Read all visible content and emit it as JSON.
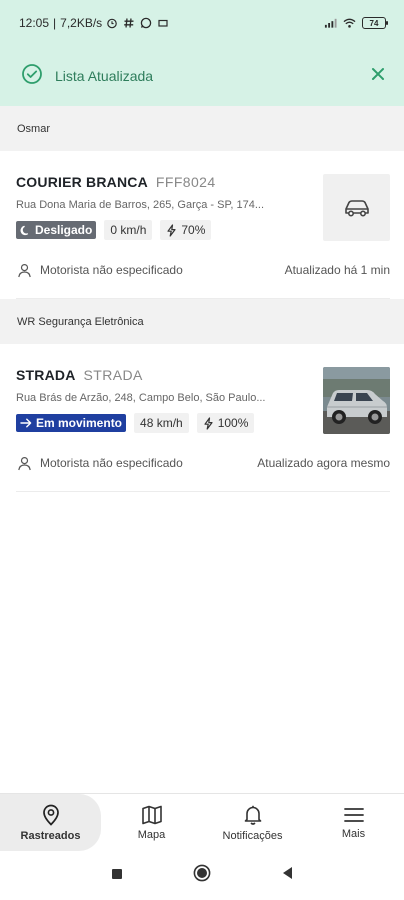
{
  "status_bar": {
    "time": "12:05",
    "network_speed": "7,2KB/s",
    "battery": "74",
    "icons": [
      "alarm-icon",
      "hashtag-icon",
      "whatsapp-icon",
      "mail-icon",
      "signal-icon",
      "wifi-icon",
      "battery-icon"
    ]
  },
  "banner": {
    "message": "Lista Atualizada",
    "icons": [
      "check-circle-icon",
      "close-icon"
    ]
  },
  "groups": [
    {
      "name": "Osmar",
      "vehicles": [
        {
          "name": "COURIER BRANCA",
          "plate": "FFF8024",
          "address": "Rua Dona Maria de Barros, 265, Garça - SP, 174...",
          "status": "Desligado",
          "speed": "0 km/h",
          "battery": "70%",
          "driver": "Motorista não especificado",
          "updated": "Atualizado há 1 min",
          "thumb": "car-outline-icon"
        }
      ]
    },
    {
      "name": "WR Segurança Eletrônica",
      "vehicles": [
        {
          "name": "STRADA",
          "plate": "STRADA",
          "address": "Rua Brás de Arzão, 248, Campo Belo, São Paulo...",
          "status": "Em movimento",
          "speed": "48 km/h",
          "battery": "100%",
          "driver": "Motorista não especificado",
          "updated": "Atualizado agora mesmo",
          "thumb": "vehicle-photo"
        }
      ]
    }
  ],
  "bottom_nav": [
    {
      "label": "Rastreados",
      "icon": "location-pin-icon",
      "active": true
    },
    {
      "label": "Mapa",
      "icon": "map-icon",
      "active": false
    },
    {
      "label": "Notificações",
      "icon": "bell-icon",
      "active": false
    },
    {
      "label": "Mais",
      "icon": "menu-icon",
      "active": false
    }
  ],
  "colors": {
    "banner_bg": "#d6f2e6",
    "banner_text": "#2e7d5b",
    "status_off": "#666b73",
    "status_moving": "#1f3fa0"
  }
}
